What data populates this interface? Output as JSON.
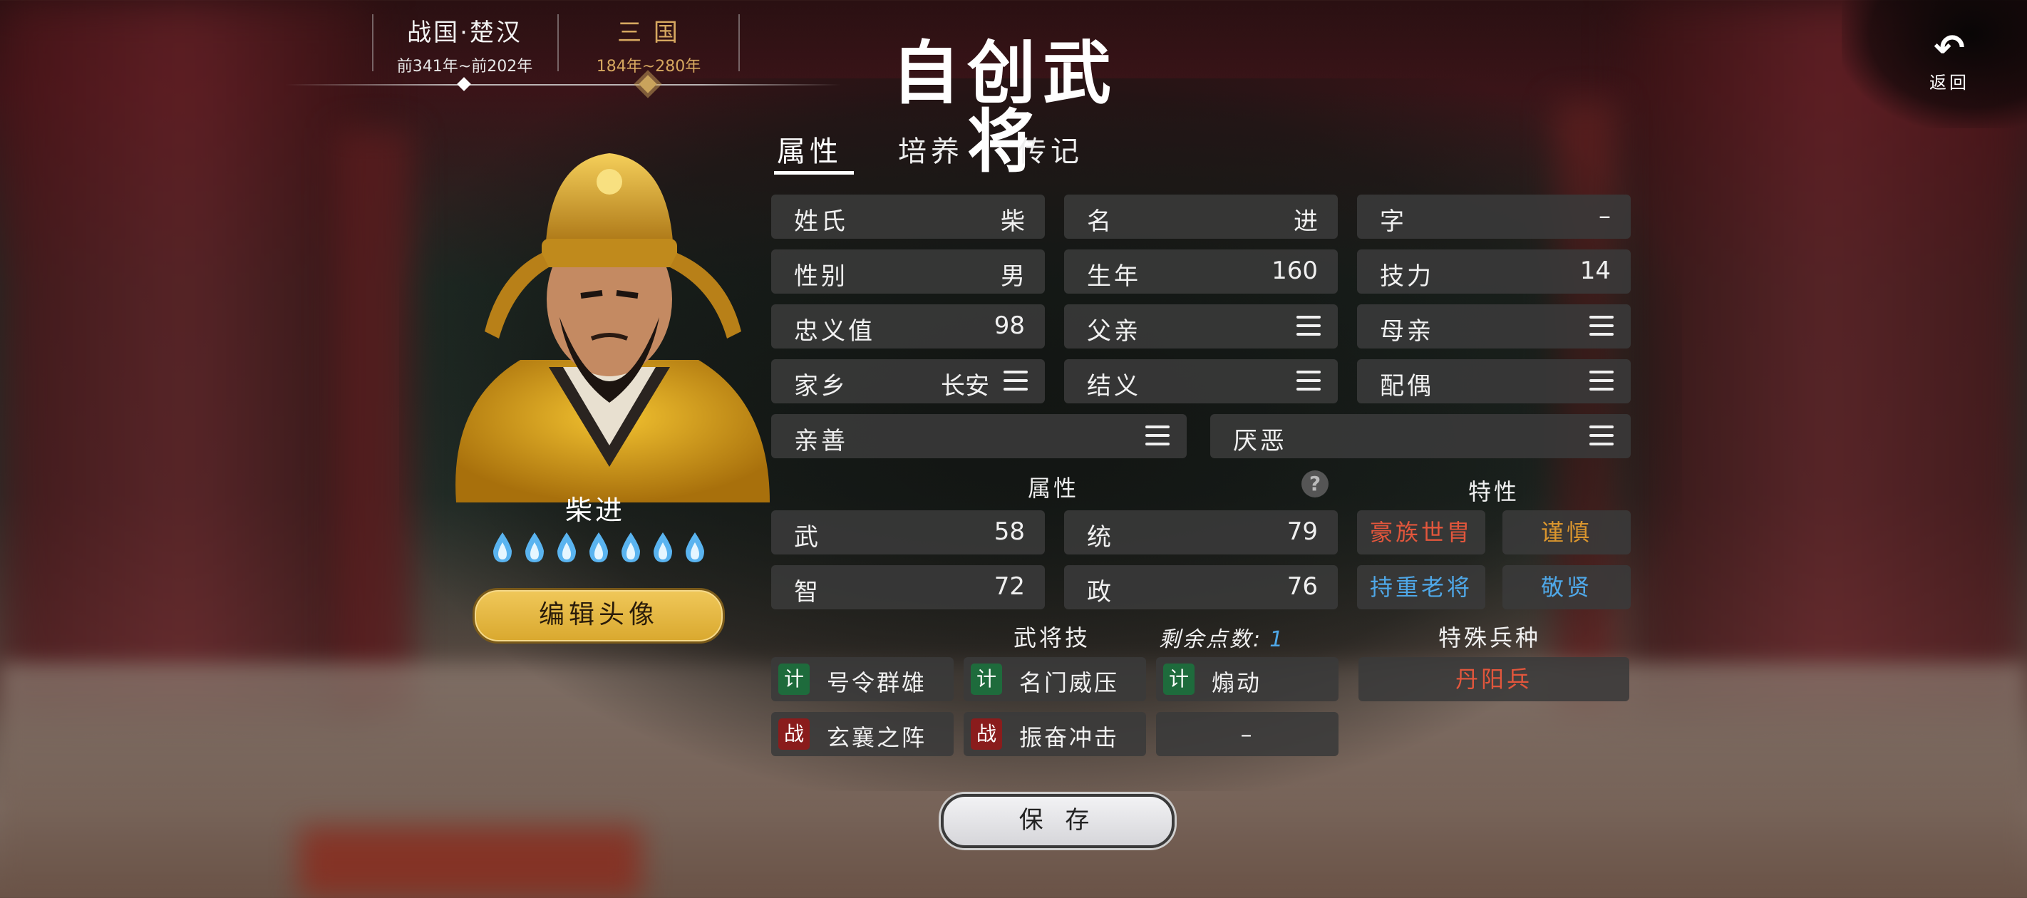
{
  "eras": [
    {
      "name": "战国·楚汉",
      "years": "前341年~前202年"
    },
    {
      "name": "三 国",
      "years": "184年~280年"
    }
  ],
  "title": "自创武将",
  "back_label": "返回",
  "hero": {
    "name": "柴进",
    "stars": 7,
    "edit_avatar": "编辑头像"
  },
  "tabs": [
    "属性",
    "培养",
    "传记"
  ],
  "info": {
    "surname": {
      "label": "姓氏",
      "value": "柴"
    },
    "given": {
      "label": "名",
      "value": "进"
    },
    "courtesy": {
      "label": "字",
      "value": "–"
    },
    "gender": {
      "label": "性别",
      "value": "男"
    },
    "birth": {
      "label": "生年",
      "value": "160"
    },
    "skill_power": {
      "label": "技力",
      "value": "14"
    },
    "loyalty": {
      "label": "忠义值",
      "value": "98"
    },
    "father": {
      "label": "父亲"
    },
    "mother": {
      "label": "母亲"
    },
    "hometown": {
      "label": "家乡",
      "value": "长安"
    },
    "sworn": {
      "label": "结义"
    },
    "spouse": {
      "label": "配偶"
    },
    "like": {
      "label": "亲善"
    },
    "dislike": {
      "label": "厌恶"
    }
  },
  "attr_title": "属性",
  "trait_title": "特性",
  "attrs": [
    {
      "label": "武",
      "value": "58"
    },
    {
      "label": "统",
      "value": "79"
    },
    {
      "label": "智",
      "value": "72"
    },
    {
      "label": "政",
      "value": "76"
    }
  ],
  "traits": [
    {
      "label": "豪族世胄",
      "color": "#e2563c"
    },
    {
      "label": "谨慎",
      "color": "#d9952e"
    },
    {
      "label": "持重老将",
      "color": "#4fa8e8"
    },
    {
      "label": "敬贤",
      "color": "#4fa8e8"
    }
  ],
  "skills_title": "武将技",
  "remaining_label": "剩余点数:",
  "remaining_value": "1",
  "troop_title": "特殊兵种",
  "troop": "丹阳兵",
  "skills": [
    {
      "badge": "计",
      "badge_color": "#1e6b3c",
      "name": "号令群雄"
    },
    {
      "badge": "计",
      "badge_color": "#1e6b3c",
      "name": "名门威压"
    },
    {
      "badge": "计",
      "badge_color": "#1e6b3c",
      "name": "煽动"
    },
    {
      "badge": "战",
      "badge_color": "#8a1c1c",
      "name": "玄襄之阵"
    },
    {
      "badge": "战",
      "badge_color": "#8a1c1c",
      "name": "振奋冲击"
    },
    {
      "name": "–"
    }
  ],
  "save_label": "保 存"
}
